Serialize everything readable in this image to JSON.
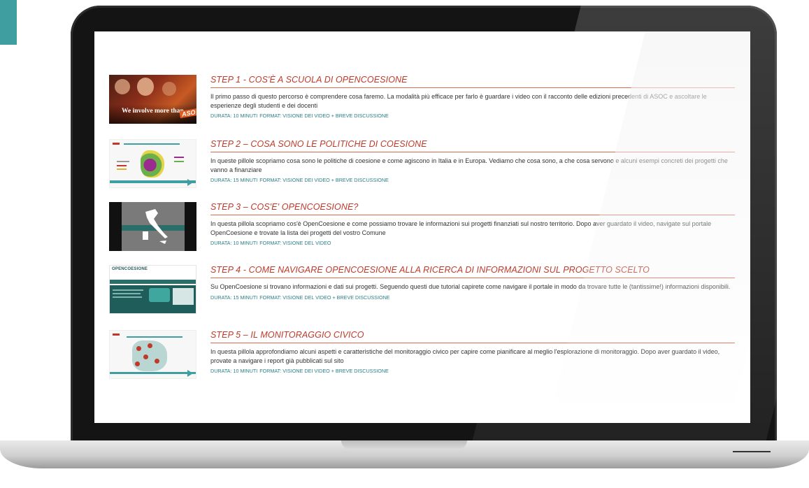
{
  "steps": [
    {
      "title": "STEP 1 - COS'È A SCUOLA DI OPENCOESIONE",
      "description": "Il primo passo di questo percorso è comprendere cosa faremo. La modalità più efficace per farlo è guardare i video con il racconto delle edizioni precedenti di ASOC e ascoltare le esperienze degli studenti e dei docenti",
      "duration": "DURATA: 10 MINUTI",
      "format": "FORMAT: VISIONE DEI VIDEO + BREVE DISCUSSIONE",
      "thumb_text": "We involve more than",
      "thumb_tag": "ASO"
    },
    {
      "title": "STEP 2 – COSA SONO LE POLITICHE DI COESIONE",
      "description": "In queste pillole scopriamo cosa sono le politiche di coesione e come agiscono in Italia e in Europa. Vediamo che cosa sono, a che cosa servono e alcuni esempi concreti dei progetti che vanno a finanziare",
      "duration": "DURATA: 15 MINUTI",
      "format": "FORMAT: VISIONE DEI VIDEO + BREVE DISCUSSIONE"
    },
    {
      "title": "STEP 3 – COS'E' OPENCOESIONE?",
      "description": "In questa pillola scopriamo cos'è OpenCoesione e come possiamo trovare le informazioni sui progetti finanziati sul nostro territorio. Dopo aver guardato il video, navigate sul portale OpenCoesione e trovate la lista dei progetti del vostro Comune",
      "duration": "DURATA: 10 MINUTI",
      "format": "FORMAT: VISIONE DEL VIDEO"
    },
    {
      "title": "STEP 4 - COME NAVIGARE OPENCOESIONE ALLA RICERCA DI INFORMAZIONI SUL PROGETTO SCELTO",
      "description": "Su OpenCoesione si trovano informazioni e dati sui progetti. Seguendo questi due tutorial capirete come navigare il portale in modo da trovare tutte le (tantissime!) informazioni disponibili.",
      "duration": "DURATA: 15 MINUTI",
      "format": "FORMAT: VISIONE DEL VIDEO + BREVE DISCUSSIONE",
      "thumb_logo": "OPENCOESIONE"
    },
    {
      "title": "STEP 5 – IL MONITORAGGIO CIVICO",
      "description": "In questa pillola approfondiamo alcuni aspetti e caratteristiche del monitoraggio civico per capire come pianificare al meglio l'esplorazione di monitoraggio. Dopo aver guardato il video, provate a navigare i report già pubblicati sul sito",
      "duration": "DURATA: 10 MINUTI",
      "format": "FORMAT: VISIONE DEI VIDEO + BREVE DISCUSSIONE"
    }
  ],
  "colors": {
    "title": "#c0392b",
    "meta": "#2a7f86",
    "accent_teal": "#3f9ea0"
  }
}
